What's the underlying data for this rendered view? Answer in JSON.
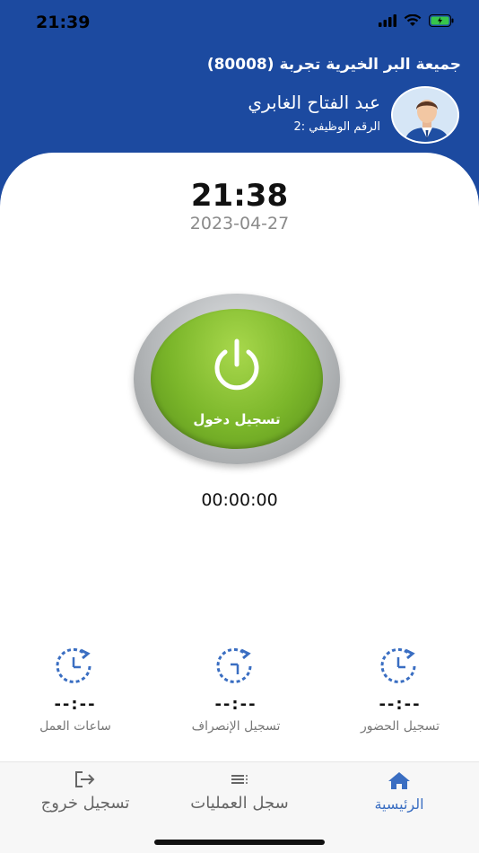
{
  "status_bar": {
    "time": "21:39"
  },
  "header": {
    "organization": "جميعة البر الخيرية تجربة (80008)",
    "user_name": "عبد الفتاح الغابري",
    "employee_id": "الرقم الوظيفي :2"
  },
  "clock": {
    "time": "21:38",
    "date": "2023-04-27"
  },
  "main_button": {
    "label": "تسجيل دخول"
  },
  "timer": "00:00:00",
  "stats": [
    {
      "value": "--:--",
      "label": "تسجيل الحضور",
      "icon": "clock-icon"
    },
    {
      "value": "--:--",
      "label": "تسجيل الإنصراف",
      "icon": "clock-icon"
    },
    {
      "value": "--:--",
      "label": "ساعات العمل",
      "icon": "clock-icon"
    }
  ],
  "tabs": [
    {
      "label": "الرئيسية",
      "icon": "home-icon",
      "active": true
    },
    {
      "label": "سجل العمليات",
      "icon": "list-icon",
      "active": false
    },
    {
      "label": "تسجيل خروج",
      "icon": "logout-icon",
      "active": false
    }
  ],
  "colors": {
    "primary": "#1c4aa0",
    "accent": "#3a6ec2",
    "button_green": "#7bb62a"
  }
}
